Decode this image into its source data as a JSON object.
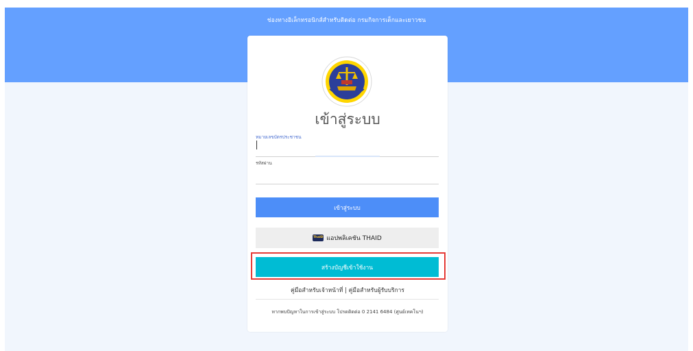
{
  "header": {
    "title": "ช่องทางอิเล็กทรอนิกส์สำหรับติดต่อ กรมกิจการเด็กและเยาวชน"
  },
  "login": {
    "heading": "เข้าสู่ระบบ",
    "id_label": "หมายเลขบัตรประชาชน",
    "id_value": "",
    "password_label": "รหัสผ่าน",
    "password_value": "",
    "login_button": "เข้าสู่ระบบ",
    "thaid_logo": "ThaID",
    "thaid_button": "แอปพลิเคชัน THAID",
    "register_button": "สร้างบัญชีเข้าใช้งาน"
  },
  "links": {
    "officer_manual": "คู่มือสำหรับเจ้าหน้าที่",
    "separator": "|",
    "user_manual": "คู่มือสำหรับผู้รับบริการ"
  },
  "footer": {
    "help_text": "หากพบปัญหาในการเข้าสู่ระบบ โปรดติดต่อ 0 2141 6484 (ศูนย์เทคโนฯ)"
  },
  "colors": {
    "header_band": "#64a0ff",
    "login_button": "#4d8ef8",
    "register_button": "#00bcd4",
    "highlight_border": "#e53935"
  },
  "icons": {
    "seal": "department-seal-icon",
    "thaid": "thaid-logo-icon"
  }
}
